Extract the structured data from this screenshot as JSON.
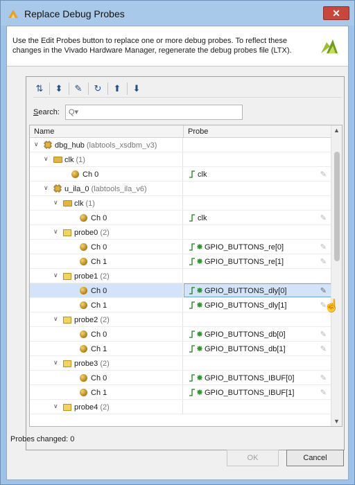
{
  "window": {
    "title": "Replace Debug Probes",
    "close_label": "✕"
  },
  "banner": {
    "text": "Use the Edit Probes button to replace one or more debug probes. To reflect these changes in the Vivado Hardware Manager, regenerate the debug probes file (LTX)."
  },
  "toolbar": {
    "buttons": [
      {
        "name": "collapse-all-button",
        "glyph": "⇅"
      },
      {
        "name": "expand-all-button",
        "glyph": "⬍"
      },
      {
        "name": "edit-probes-button",
        "glyph": "✎"
      },
      {
        "name": "refresh-button",
        "glyph": "↻"
      },
      {
        "name": "move-up-button",
        "glyph": "⬆"
      },
      {
        "name": "move-down-button",
        "glyph": "⬇"
      }
    ]
  },
  "search": {
    "label_first": "S",
    "label_rest": "earch:",
    "placeholder": "Q▾"
  },
  "table": {
    "col_name": "Name",
    "col_probe": "Probe",
    "rows": [
      {
        "n": "dbg_hub",
        "m": "(labtools_xsdbm_v3)",
        "p": "",
        "k": 0
      },
      {
        "n": "clk",
        "m": "(1)",
        "p": "",
        "k": 1
      },
      {
        "n": "Ch 0",
        "m": "",
        "p": "clk",
        "k": 2
      },
      {
        "n": "u_ila_0",
        "m": "(labtools_ila_v6)",
        "p": "",
        "k": 3
      },
      {
        "n": "clk",
        "m": "(1)",
        "p": "",
        "k": 4
      },
      {
        "n": "Ch 0",
        "m": "",
        "p": "clk",
        "k": 5
      },
      {
        "n": "probe0",
        "m": "(2)",
        "p": "",
        "k": 6
      },
      {
        "n": "Ch 0",
        "m": "",
        "p": "GPIO_BUTTONS_re[0]",
        "k": 7
      },
      {
        "n": "Ch 1",
        "m": "",
        "p": "GPIO_BUTTONS_re[1]",
        "k": 8
      },
      {
        "n": "probe1",
        "m": "(2)",
        "p": "",
        "k": 9
      },
      {
        "n": "Ch 0",
        "m": "",
        "p": "GPIO_BUTTONS_dly[0]",
        "k": 10
      },
      {
        "n": "Ch 1",
        "m": "",
        "p": "GPIO_BUTTONS_dly[1]",
        "k": 11
      },
      {
        "n": "probe2",
        "m": "(2)",
        "p": "",
        "k": 12
      },
      {
        "n": "Ch 0",
        "m": "",
        "p": "GPIO_BUTTONS_db[0]",
        "k": 13
      },
      {
        "n": "Ch 1",
        "m": "",
        "p": "GPIO_BUTTONS_db[1]",
        "k": 14
      },
      {
        "n": "probe3",
        "m": "(2)",
        "p": "",
        "k": 15
      },
      {
        "n": "Ch 0",
        "m": "",
        "p": "GPIO_BUTTONS_IBUF[0]",
        "k": 16
      },
      {
        "n": "Ch 1",
        "m": "",
        "p": "GPIO_BUTTONS_IBUF[1]",
        "k": 17
      },
      {
        "n": "probe4",
        "m": "(2)",
        "p": "",
        "k": 18
      }
    ]
  },
  "status": {
    "text": "Probes changed: 0"
  },
  "buttons": {
    "ok": "OK",
    "cancel": "Cancel"
  }
}
